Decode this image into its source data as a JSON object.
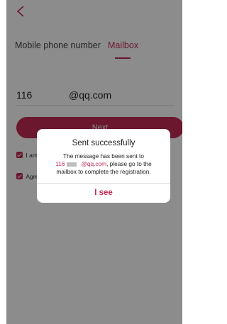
{
  "header": {
    "back_icon": "chevron-left-icon"
  },
  "tabs": [
    {
      "label": "Mobile phone number",
      "active": false
    },
    {
      "label": "Mailbox",
      "active": true
    }
  ],
  "email": {
    "prefix": "116",
    "suffix": "@qq.com"
  },
  "next_label": "Next",
  "checks": [
    {
      "label": "I am",
      "checked": true
    },
    {
      "label": "Agre",
      "checked": true
    }
  ],
  "dialog": {
    "title": "Sent successfully",
    "line1": "The message has been sent to",
    "number": "116",
    "suffix": "@qq.com",
    "line2_tail": ", please go to the",
    "line3": "mailbox to complete the registration.",
    "button": "I see"
  },
  "colors": {
    "accent": "#c42b55",
    "overlay": "rgba(0,0,0,0.45)"
  }
}
